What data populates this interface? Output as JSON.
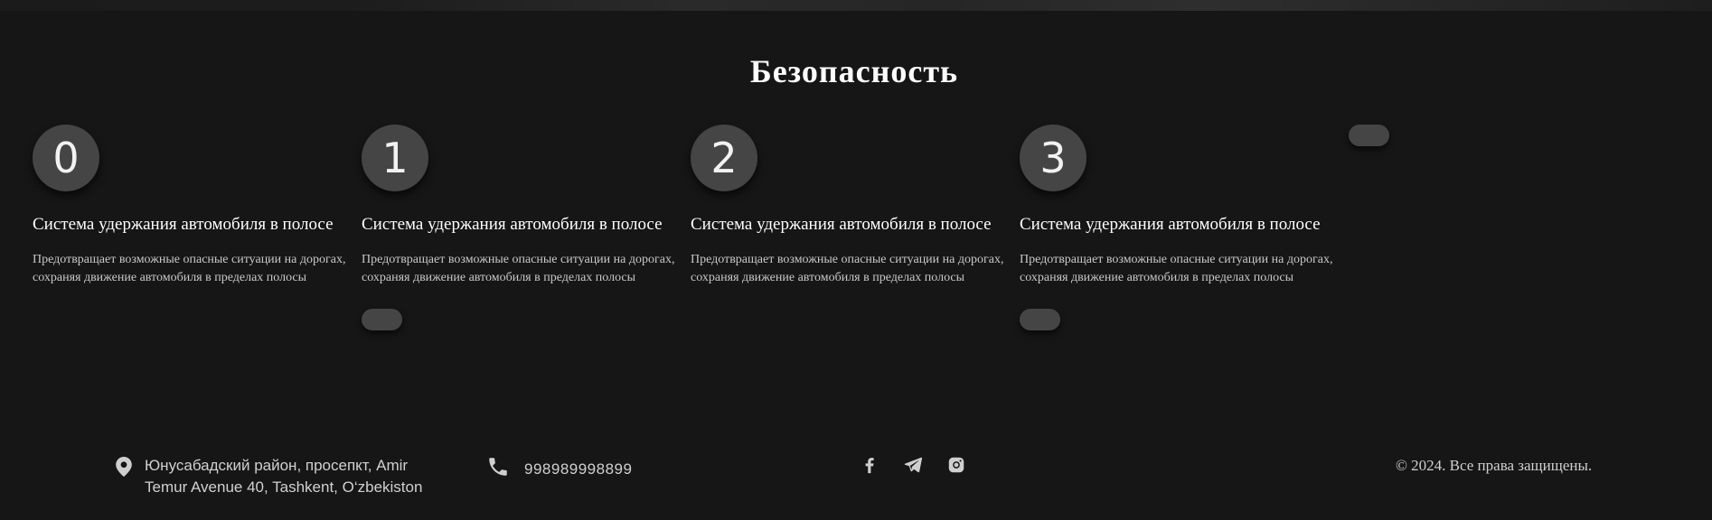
{
  "section": {
    "title": "Безопасность"
  },
  "cards": [
    {
      "number": "0",
      "title": "Система удержания автомобиля в полосе",
      "description": "Предотвращает возможные опасные ситуации на дорогах, сохраняя движение автомобиля в пределах полосы",
      "has_button": false
    },
    {
      "number": "1",
      "title": "Система удержания автомобиля в полосе",
      "description": "Предотвращает возможные опасные ситуации на дорогах, сохраняя движение автомобиля в пределах полосы",
      "has_button": true
    },
    {
      "number": "2",
      "title": "Система удержания автомобиля в полосе",
      "description": "Предотвращает возможные опасные ситуации на дорогах, сохраняя движение автомобиля в пределах полосы",
      "has_button": false
    },
    {
      "number": "3",
      "title": "Система удержания автомобиля в полосе",
      "description": "Предотвращает возможные опасные ситуации на дорогах, сохраняя движение автомобиля в пределах полосы",
      "has_button": true
    }
  ],
  "footer": {
    "address": "Юнусабадский район, просепкт, Amir Temur Avenue 40, Tashkent, O‘zbekiston",
    "phone": "998989998899",
    "social": [
      "facebook-icon",
      "telegram-icon",
      "instagram-icon"
    ],
    "copyright": "© 2024. Все права защищены."
  },
  "colors": {
    "background": "#161616",
    "circle": "#454545",
    "text": "#ffffff",
    "muted": "#c8c8c8"
  }
}
